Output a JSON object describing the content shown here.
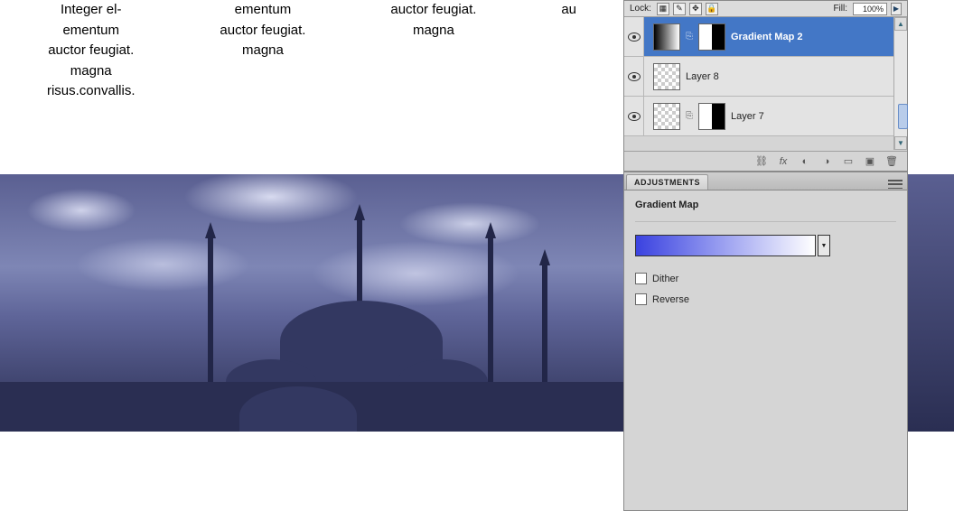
{
  "canvas": {
    "col1": "Integer el-\nementum\nauctor feugiat.\nmagna\nrisus.convallis.",
    "col2": "ementum\nauctor feugiat.\nmagna",
    "col3": "auctor feugiat.\nmagna",
    "col4": "au"
  },
  "layers_panel": {
    "lock_label": "Lock:",
    "fill_label": "Fill:",
    "fill_value": "100%",
    "rows": [
      {
        "name": "Gradient Map 2",
        "selected": true
      },
      {
        "name": "Layer 8"
      },
      {
        "name": "Layer 7"
      }
    ]
  },
  "adjustments": {
    "tab": "ADJUSTMENTS",
    "title": "Gradient Map",
    "dither": "Dither",
    "reverse": "Reverse"
  }
}
